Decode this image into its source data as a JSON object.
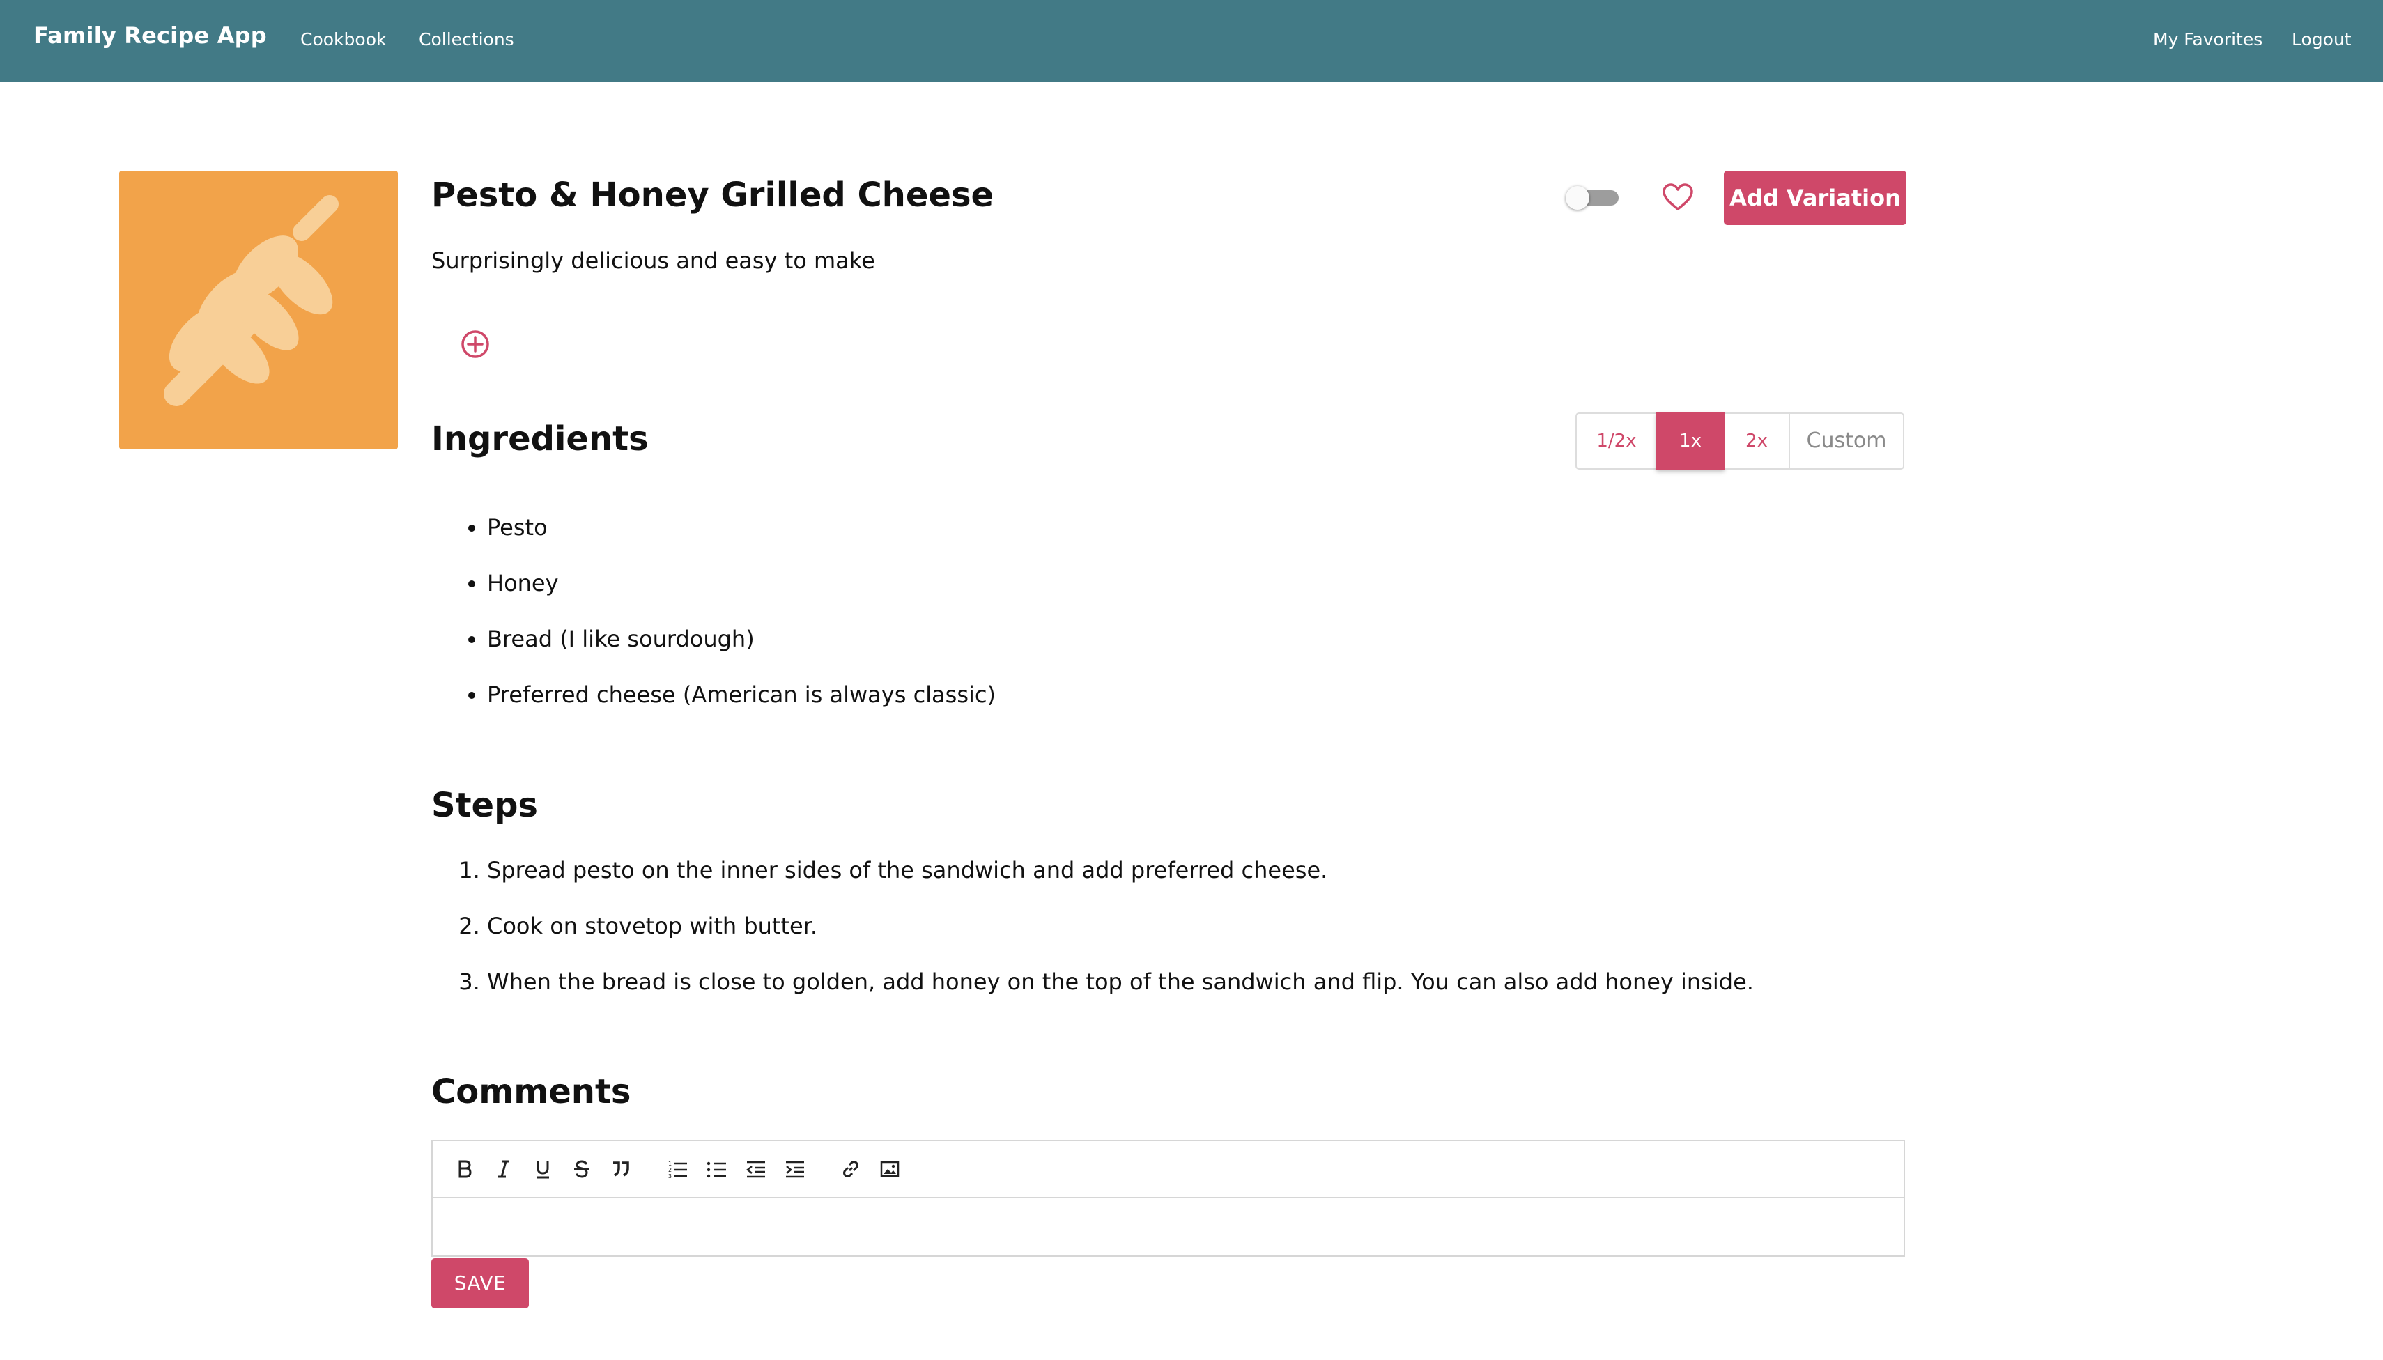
{
  "navbar": {
    "brand": "Family Recipe App",
    "links": [
      "Cookbook",
      "Collections"
    ],
    "right_links": [
      "My Favorites",
      "Logout"
    ],
    "bg_color": "#427a86"
  },
  "recipe": {
    "image_icon": "wheat-icon",
    "image_bg": "#f2a34a",
    "title": "Pesto & Honey Grilled Cheese",
    "description": "Surprisingly delicious and easy to make",
    "toggle_on": false,
    "favorited": false,
    "add_variation_label": "Add Variation"
  },
  "ingredients": {
    "heading": "Ingredients",
    "scale_options": [
      "1/2x",
      "1x",
      "2x",
      "Custom"
    ],
    "selected_scale": "1x",
    "items": [
      "Pesto",
      "Honey",
      "Bread (I like sourdough)",
      "Preferred cheese (American is always classic)"
    ]
  },
  "steps": {
    "heading": "Steps",
    "items": [
      "Spread pesto on the inner sides of the sandwich and add preferred cheese.",
      "Cook on stovetop with butter.",
      "When the bread is close to golden, add honey on the top of the sandwich and flip. You can also add honey inside."
    ]
  },
  "comments": {
    "heading": "Comments",
    "toolbar": [
      "bold-icon",
      "italic-icon",
      "underline-icon",
      "strikethrough-icon",
      "quote-icon",
      "ordered-list-icon",
      "bullet-list-icon",
      "outdent-icon",
      "indent-icon",
      "link-icon",
      "image-icon"
    ],
    "editor_value": "",
    "save_label": "SAVE"
  },
  "accent_color": "#cf4869"
}
